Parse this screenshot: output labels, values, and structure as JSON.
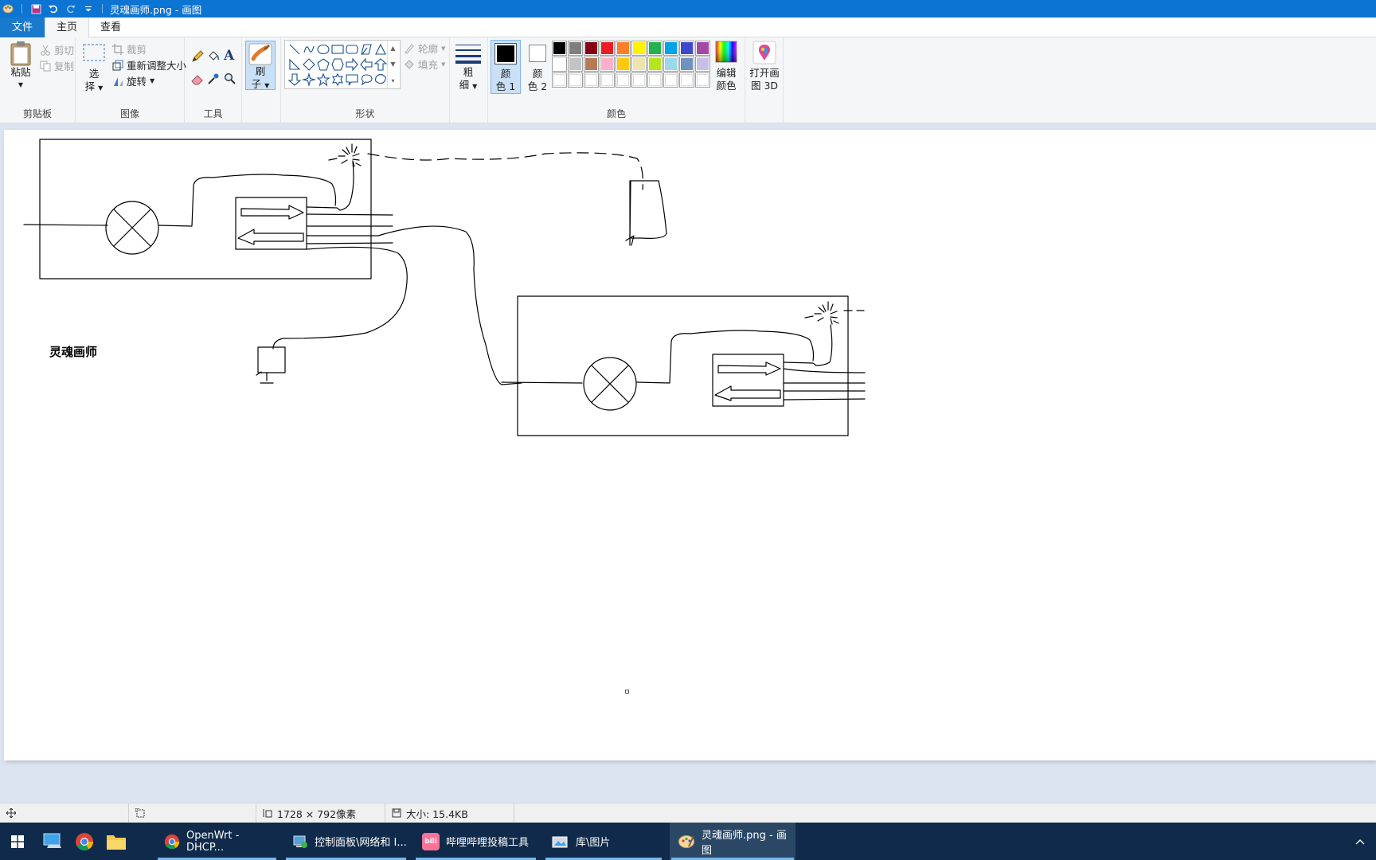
{
  "window": {
    "title": "灵魂画师.png - 画图"
  },
  "tabs": {
    "file": "文件",
    "home": "主页",
    "view": "查看"
  },
  "clipboard": {
    "paste": "粘贴",
    "cut": "剪切",
    "copy": "复制",
    "label": "剪贴板"
  },
  "image": {
    "select_line1": "选",
    "select_line2": "择",
    "crop": "裁剪",
    "resize": "重新调整大小",
    "rotate": "旋转",
    "label": "图像"
  },
  "tools": {
    "label": "工具",
    "text_tool": "A"
  },
  "brushes": {
    "line1": "刷",
    "line2": "子"
  },
  "shapes": {
    "outline": "轮廓",
    "fill": "填充",
    "label": "形状"
  },
  "size": {
    "line1": "粗",
    "line2": "细"
  },
  "colors": {
    "color1_line1": "颜",
    "color1_line2": "色 1",
    "color2_line1": "颜",
    "color2_line2": "色 2",
    "edit_line1": "编辑",
    "edit_line2": "颜色",
    "label": "颜色",
    "color1_value": "#000000",
    "color2_value": "#ffffff",
    "palette_row1": [
      "#000000",
      "#7f7f7f",
      "#880015",
      "#ed1c24",
      "#ff7f27",
      "#fff200",
      "#22b14c",
      "#00a2e8",
      "#3f48cc",
      "#a349a4"
    ],
    "palette_row2": [
      "#ffffff",
      "#c3c3c3",
      "#b97a57",
      "#ffaec9",
      "#ffc90e",
      "#efe4b0",
      "#b5e61d",
      "#99d9ea",
      "#7092be",
      "#c8bfe7"
    ]
  },
  "paint3d": {
    "line1": "打开画",
    "line2": "图 3D"
  },
  "canvas": {
    "drawing_text": "灵魂画师"
  },
  "status": {
    "dimensions": "1728 × 792像素",
    "size": "大小: 15.4KB"
  },
  "taskbar": {
    "items": [
      {
        "label": "OpenWrt - DHCP..."
      },
      {
        "label": "控制面板\\网络和 I..."
      },
      {
        "label": "哔哩哔哩投稿工具"
      },
      {
        "label": "库\\图片"
      },
      {
        "label": "灵魂画师.png - 画图"
      }
    ],
    "bili_icon_text": "bili"
  }
}
